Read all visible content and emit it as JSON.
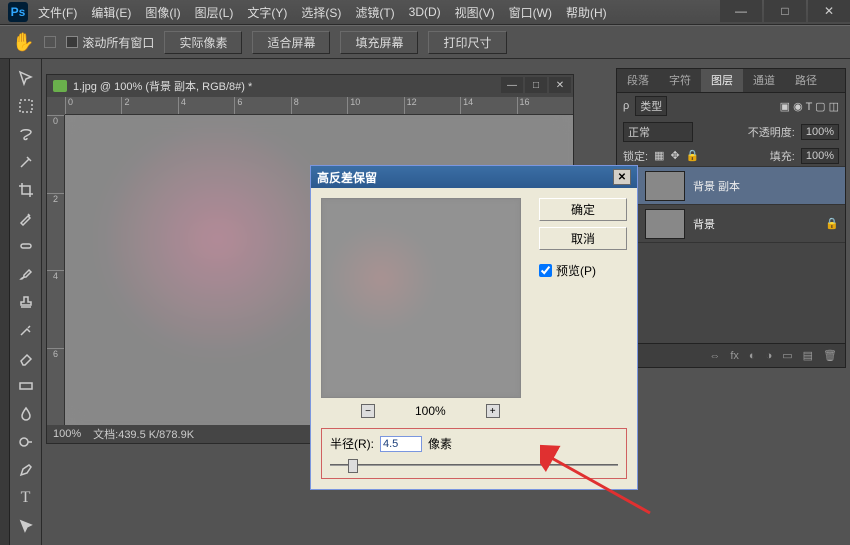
{
  "app": {
    "logo": "Ps"
  },
  "menu": {
    "file": "文件(F)",
    "edit": "编辑(E)",
    "image": "图像(I)",
    "layer": "图层(L)",
    "type": "文字(Y)",
    "select": "选择(S)",
    "filter": "滤镜(T)",
    "threeD": "3D(D)",
    "view": "视图(V)",
    "window": "窗口(W)",
    "help": "帮助(H)"
  },
  "options": {
    "scroll_all": "滚动所有窗口",
    "btn_actual": "实际像素",
    "btn_fit": "适合屏幕",
    "btn_fill": "填充屏幕",
    "btn_print": "打印尺寸"
  },
  "doc": {
    "title": "1.jpg @ 100% (背景 副本, RGB/8#) *",
    "ruler_h": [
      "0",
      "2",
      "4",
      "6",
      "8",
      "10",
      "12",
      "14",
      "16"
    ],
    "ruler_v": [
      "0",
      "2",
      "4",
      "6"
    ],
    "zoom": "100%",
    "status": "文档:439.5 K/878.9K"
  },
  "panels": {
    "tabs": {
      "paragraph": "段落",
      "char": "字符",
      "layers": "图层",
      "channels": "通道",
      "paths": "路径"
    },
    "kind_label": "类型",
    "blend_mode": "正常",
    "opacity_label": "不透明度:",
    "opacity_value": "100%",
    "lock_label": "锁定:",
    "fill_label": "填充:",
    "fill_value": "100%",
    "layer1": "背景 副本",
    "layer2": "背景"
  },
  "dialog": {
    "title": "高反差保留",
    "ok": "确定",
    "cancel": "取消",
    "preview_label": "预览(P)",
    "zoom": "100%",
    "radius_label": "半径(R):",
    "radius_value": "4.5",
    "radius_unit": "像素"
  }
}
